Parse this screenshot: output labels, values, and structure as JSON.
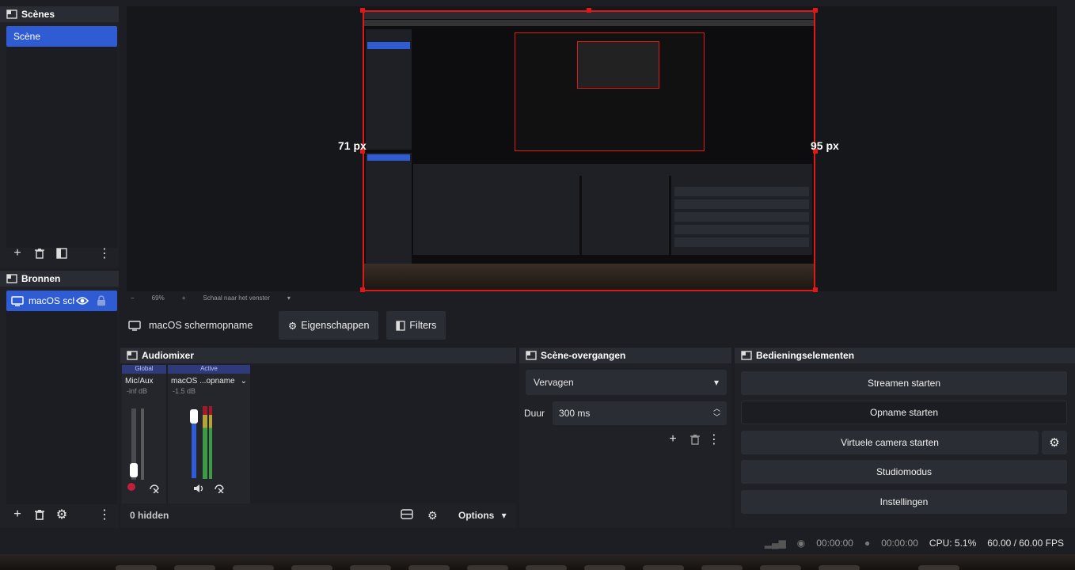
{
  "scenes": {
    "title": "Scènes",
    "items": [
      "Scène"
    ]
  },
  "sources": {
    "title": "Bronnen",
    "items": [
      {
        "label": "macOS sch"
      }
    ]
  },
  "preview": {
    "left_crop": "71 px",
    "right_crop": "95 px",
    "toolbar": {
      "minus": "−",
      "zoom": "69%",
      "plus": "+",
      "fit": "Schaal naar het venster"
    }
  },
  "context_bar": {
    "source_name": "macOS schermopname",
    "properties": "Eigenschappen",
    "filters": "Filters"
  },
  "audiomixer": {
    "title": "Audiomixer",
    "channels": [
      {
        "tag": "Global",
        "name": "Mic/Aux",
        "db": "-inf dB"
      },
      {
        "tag": "Active",
        "name": "macOS ...opname",
        "db": "-1.5 dB"
      }
    ],
    "hidden": "0 hidden",
    "options": "Options"
  },
  "transitions": {
    "title": "Scène-overgangen",
    "selected": "Vervagen",
    "duration_label": "Duur",
    "duration_value": "300 ms"
  },
  "controls": {
    "title": "Bedieningselementen",
    "buttons": [
      "Streamen starten",
      "Opname starten",
      "Virtuele camera starten",
      "Studiomodus",
      "Instellingen"
    ]
  },
  "status": {
    "stream_time": "00:00:00",
    "rec_time": "00:00:00",
    "cpu": "CPU: 5.1%",
    "fps": "60.00 / 60.00 FPS"
  },
  "colors": {
    "accent": "#2f5bd3",
    "crop_border": "#e01818"
  }
}
